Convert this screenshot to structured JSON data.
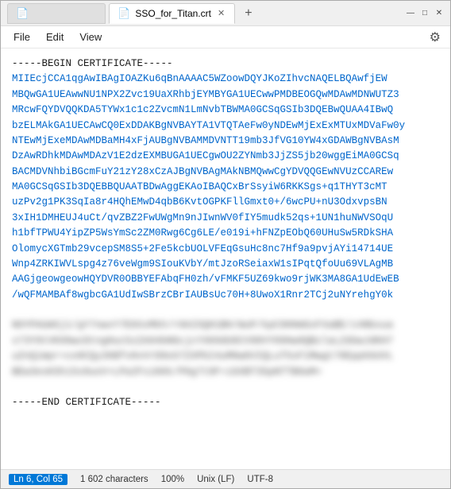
{
  "window": {
    "title": "SSO_for_Titan.crt"
  },
  "tabs": [
    {
      "id": "tab-inactive",
      "label": "",
      "active": false,
      "has_close": false
    },
    {
      "id": "tab-active",
      "label": "SSO_for_Titan.crt",
      "active": true,
      "has_close": true
    }
  ],
  "tab_new_label": "+",
  "win_controls": {
    "minimize": "—",
    "maximize": "□",
    "close": "✕"
  },
  "menu": {
    "items": [
      "File",
      "Edit",
      "View"
    ],
    "gear_label": "⚙"
  },
  "editor": {
    "line1": "-----BEGIN CERTIFICATE-----",
    "content_blue": "MIIEcjCCA1qgAwIBAgIOAZKu6qBnAAAAC5WZoowDQYJKoZIhvcNAQELBQAwfjEW\nMBQGA1UEAwwNU1NPX2Zvc19UaXRhbjEYMBYGA1UECwwPMDBEOGQwMDAwMDNWUTZ3\nMRcwFQYDVQQKDA5TYWx1c1c2ZvcmN1LmNvbTBWMA0GCSqGSIb3DQEBwQUAA4IBwQ\nbzELMAkGA1UECAwCQ0ExDDAKBgNVBAYTA1VTQTAeFw0yNDEwMjExExMTUxMDVaFw0y\nNTEwMjExeMDAwMDBaMH4xFjAUBgNVBAMMDVNTT19mb3JfVG10YW4xGDAWBgNVBAsM\nDzAwRDhkMDAwMDAzV1E2dzEXMBUGA1UECgwOU2ZYNmb3JjZS5jb20wggEiMA0GCSq\nBACMDVNhbiBGcmFuY21zY28xCzAJBgNVBAgMAkNBMQwwCgYDVQQGEwNVUzCCAREw\nMA0GCSqGSIb3DQEBBQUAATBDwAggEKAoIBAQCxBrSsyiW6RKKSgs+q1THYT3cMT\nuzPv2g1PK3SqIa8r4HQhEMwD4qbB6KvtOGPKFllGmxt0+/6wcPU+nU3OdxvpsBN\n3xIH1DMHEUJ4uCt/qvZBZ2FwUWgMn9nJIwnWV0fIY5mudk52qs+1UN1huNWVSOqU\nh1bfTPWU4YipZP5WsYmSc2ZM0Rwg6Cg6LE/e019i+hFNZpEObQ60UHuSw5RDkSHA\nOlomycXGTmb29vcepSM8S5+2Fe5kcbUOLVFEqGsuHc8nc7Hf9a9pvjAYi14714UE\nWnp4ZRKIWVLspg4z76veWgm9SIouKVbY/mtJzoRSeiaxW1sIPqtQfoUu69VLAgMB\nAAGjgeowgeowHQYDVR0OBBYEFAbqFH0zh/vFMKF5UZ69kwo9rjWK3MA8GA1UdEwEB\n/wQFMAMBAf8wgbcGA1UdIwSBrzCBrIAUBsUc70H+8UwoX1Rnr2TCj2uNYrehgY0k",
    "blurred_line": "NOYPAUm5j1/gY7nwvY7E6XxMkh/r0AI5QH1BH/WuP/kpC9HHmGxFXaBE/z4Nbxua\ns73Y9tVK99wcDtngHuc5zZA94bNGcjcYXK0dU6CV98VY09Hw9QBzlaLZdUwJdKH7\nuZnQimpr+co9CQy2KBfv0vVrD9oS7ZXPbI4uM0wGVIQLuT5sF1Mwgt78EppkbUVL\nBEw3esKShi5s9uoV+LPa2FsiKKk/P6g7t9F+iGXBT35pNTTB0aM=",
    "line_end": "-----END CERTIFICATE-----"
  },
  "status_bar": {
    "position": "Ln 6, Col 65",
    "characters": "1 602 characters",
    "zoom": "100%",
    "line_ending": "Unix (LF)",
    "encoding": "UTF-8"
  }
}
